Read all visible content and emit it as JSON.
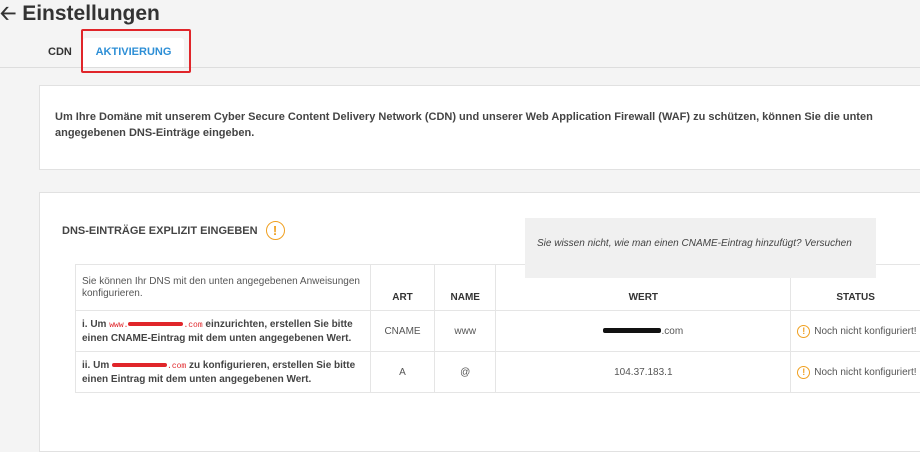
{
  "header": {
    "title": "Einstellungen",
    "back_icon": "arrow-left-icon"
  },
  "tabs": [
    {
      "label": "CDN",
      "active": false
    },
    {
      "label": "AKTIVIERUNG",
      "active": true
    }
  ],
  "intro": {
    "text": "Um Ihre Domäne mit unserem Cyber Secure Content Delivery Network (CDN) und unserer Web Application Firewall (WAF) zu schützen, können Sie die unten angegebenen DNS-Einträge eingeben."
  },
  "dns_section": {
    "title": "DNS-EINTRÄGE EXPLIZIT EINGEBEN",
    "table": {
      "headers": {
        "instructions": "Sie können Ihr DNS mit den unten angegebenen Anweisungen konfigurieren.",
        "art": "ART",
        "name": "NAME",
        "wert": "WERT",
        "status": "STATUS"
      },
      "rows": [
        {
          "prefix": "i. Um ",
          "domain_start": "www.",
          "domain_end": ".com",
          "suffix": " einzurichten, erstellen Sie bitte einen CNAME-Eintrag mit dem unten angegebenen Wert.",
          "art": "CNAME",
          "name": "www",
          "wert_suffix": ".com",
          "status": "Noch nicht konfiguriert!"
        },
        {
          "prefix": "ii. Um ",
          "domain_start": "",
          "domain_end": ".com",
          "suffix": " zu konfigurieren, erstellen Sie bitte einen Eintrag mit dem unten angegebenen Wert.",
          "art": "A",
          "name": "@",
          "wert": "104.37.183.1",
          "status": "Noch nicht konfiguriert!"
        }
      ]
    }
  },
  "help": {
    "text": "Sie wissen nicht, wie man einen CNAME-Eintrag hinzufügt? Versuchen"
  },
  "colors": {
    "accent": "#2e8fd6",
    "highlight": "#e0252a",
    "warning": "#f0a020"
  }
}
